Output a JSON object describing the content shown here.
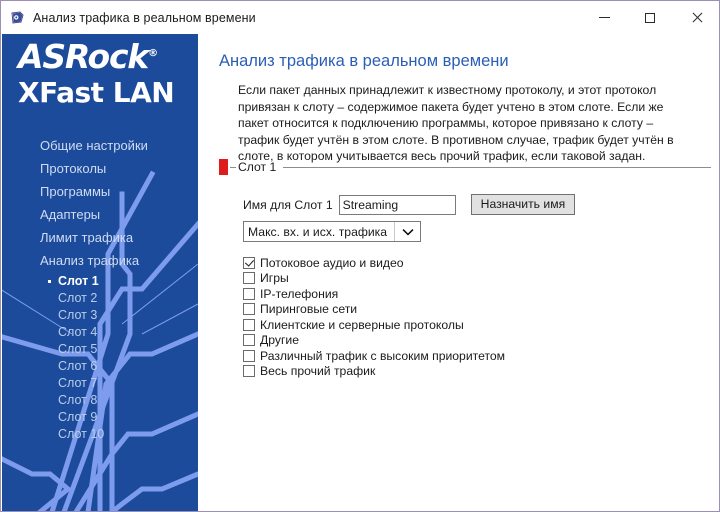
{
  "window": {
    "title": "Анализ трафика в реальном времени",
    "title_icon": "app-network-icon",
    "controls": {
      "minimize": "minimize-icon",
      "maximize": "maximize-icon",
      "close": "close-icon"
    }
  },
  "colors": {
    "sidebar_bg": "#1d4b9c",
    "trace": "#7e9ced",
    "accent_title": "#2b5eb8",
    "marker_red": "#e01b1b",
    "border": "#9b8fb5"
  },
  "sidebar": {
    "logo": {
      "brand": "ASRock",
      "registered": "®",
      "product": "XFast LAN"
    },
    "items": [
      {
        "label": "Общие настройки"
      },
      {
        "label": "Протоколы"
      },
      {
        "label": "Программы"
      },
      {
        "label": "Адаптеры"
      },
      {
        "label": "Лимит трафика"
      },
      {
        "label": "Анализ трафика"
      }
    ],
    "slots": [
      {
        "label": "Слот 1",
        "active": true
      },
      {
        "label": "Слот 2",
        "active": false
      },
      {
        "label": "Слот 3",
        "active": false
      },
      {
        "label": "Слот 4",
        "active": false
      },
      {
        "label": "Слот 5",
        "active": false
      },
      {
        "label": "Слот 6",
        "active": false
      },
      {
        "label": "Слот 7",
        "active": false
      },
      {
        "label": "Слот 8",
        "active": false
      },
      {
        "label": "Слот 9",
        "active": false
      },
      {
        "label": "Слот 10",
        "active": false
      }
    ]
  },
  "main": {
    "page_title": "Анализ трафика в реальном времени",
    "intro": "Если пакет данных принадлежит к известному протоколу, и этот протокол привязан к слоту – содержимое пакета будет учтено в этом слоте. Если же пакет относится к подключению программы, которое привязано к слоту – трафик будет учтён в этом слоте. В противном случае, трафик будет учтён в слоте, в котором учитывается весь прочий трафик, если таковой задан.",
    "group": {
      "title": "Слот 1",
      "name_label": "Имя для Слот 1",
      "name_value": "Streaming",
      "name_placeholder": "",
      "assign_button": "Назначить имя",
      "metric_selected": "Макс. вх. и исх. трафика",
      "metric_options": [
        "Макс. вх. и исх. трафика"
      ],
      "checkboxes": [
        {
          "label": "Потоковое аудио и видео",
          "checked": true
        },
        {
          "label": "Игры",
          "checked": false
        },
        {
          "label": "IP-телефония",
          "checked": false
        },
        {
          "label": "Пиринговые сети",
          "checked": false
        },
        {
          "label": "Клиентские и серверные протоколы",
          "checked": false
        },
        {
          "label": "Другие",
          "checked": false
        },
        {
          "label": "Различный трафик с высоким приоритетом",
          "checked": false
        },
        {
          "label": "Весь прочий трафик",
          "checked": false
        }
      ]
    }
  }
}
